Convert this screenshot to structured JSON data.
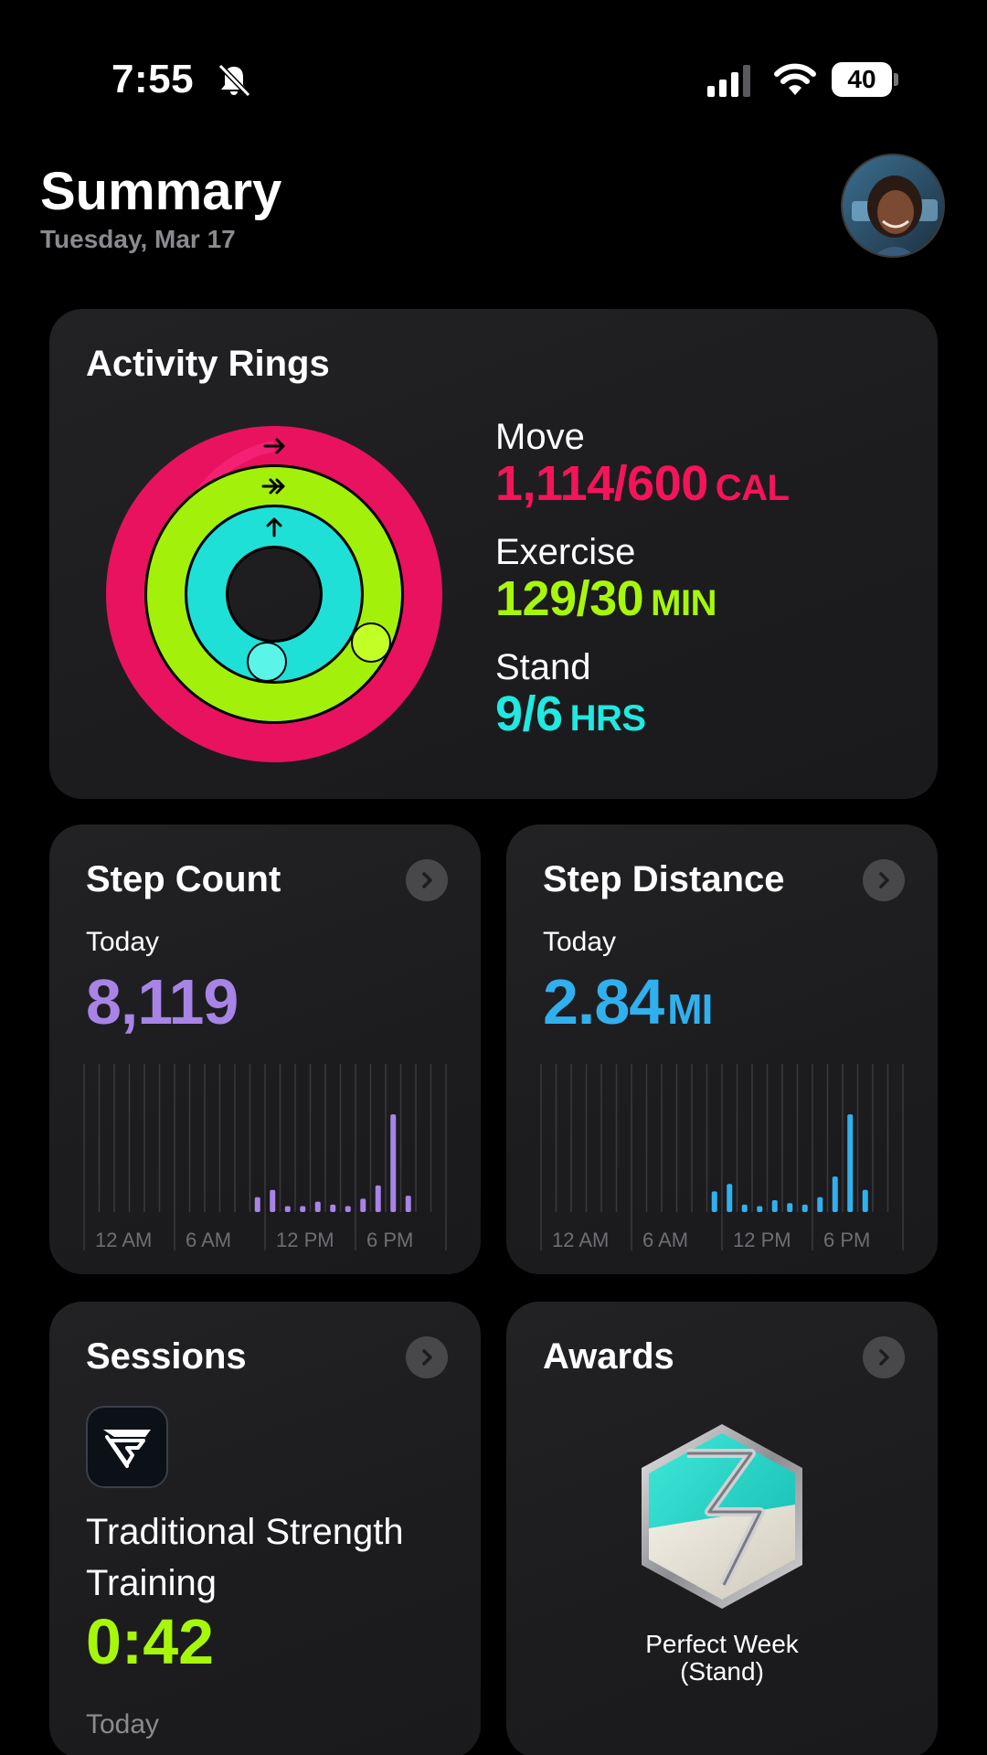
{
  "status_bar": {
    "time": "7:55",
    "battery": "40",
    "icons": [
      "bell-slash-icon",
      "cellular-signal-icon",
      "wifi-icon",
      "battery-icon"
    ]
  },
  "header": {
    "title": "Summary",
    "date": "Tuesday, Mar 17",
    "avatar": "profile-photo"
  },
  "activity_rings": {
    "title": "Activity Rings",
    "move": {
      "label": "Move",
      "value": "1,114/600",
      "unit": "CAL",
      "color": "#f5145a",
      "progress": 1.857
    },
    "exercise": {
      "label": "Exercise",
      "value": "129/30",
      "unit": "MIN",
      "color": "#a7f70b",
      "progress": 4.3
    },
    "stand": {
      "label": "Stand",
      "value": "9/6",
      "unit": "HRS",
      "color": "#21e8e0",
      "progress": 1.5
    }
  },
  "step_count": {
    "title": "Step Count",
    "period": "Today",
    "value": "8,119",
    "color": "#a784e6",
    "axis_labels": [
      "12 AM",
      "6 AM",
      "12 PM",
      "6 PM"
    ],
    "hourly": [
      0,
      0,
      0,
      0,
      0,
      0,
      0,
      0,
      0,
      0,
      0,
      0.1,
      0.15,
      0.04,
      0.04,
      0.07,
      0.05,
      0.04,
      0.09,
      0.18,
      0.66,
      0.11,
      0,
      0
    ]
  },
  "step_distance": {
    "title": "Step Distance",
    "period": "Today",
    "value": "2.84",
    "unit": "MI",
    "color": "#30b0ee",
    "axis_labels": [
      "12 AM",
      "6 AM",
      "12 PM",
      "6 PM"
    ],
    "hourly": [
      0,
      0,
      0,
      0,
      0,
      0,
      0,
      0,
      0,
      0,
      0,
      0.14,
      0.19,
      0.05,
      0.04,
      0.08,
      0.06,
      0.05,
      0.1,
      0.24,
      0.66,
      0.15,
      0,
      0
    ]
  },
  "sessions": {
    "title": "Sessions",
    "workout_name": "Traditional Strength Training",
    "duration": "0:42",
    "date": "Today",
    "duration_color": "#a7f70b"
  },
  "awards": {
    "title": "Awards",
    "award_name_line1": "Perfect Week",
    "award_name_line2": "(Stand)"
  }
}
